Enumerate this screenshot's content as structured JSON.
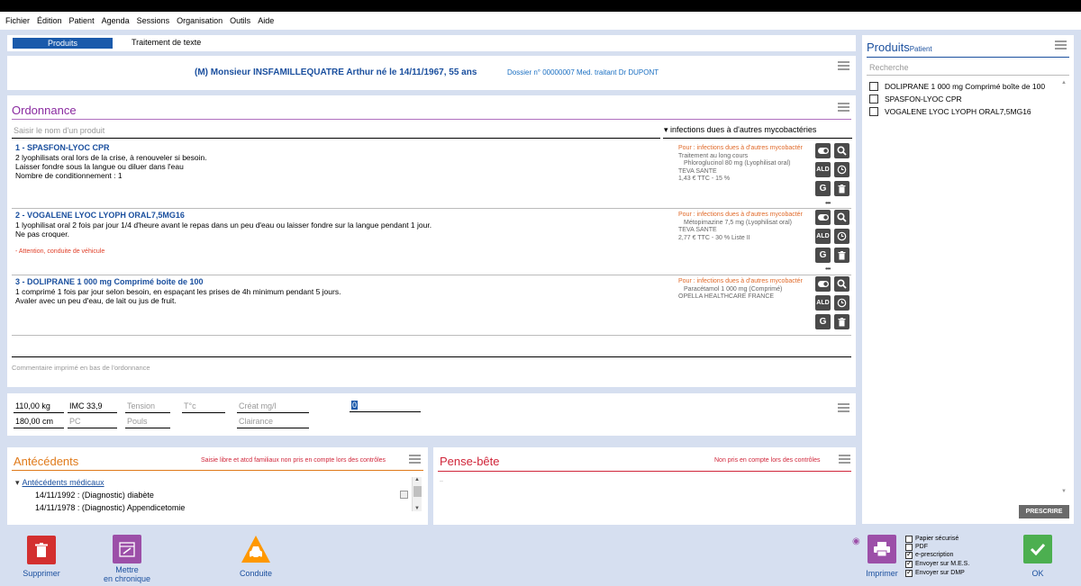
{
  "menu": [
    "Fichier",
    "Édition",
    "Patient",
    "Agenda",
    "Sessions",
    "Organisation",
    "Outils",
    "Aide"
  ],
  "tabs": {
    "active": "Produits",
    "other": "Traitement de texte"
  },
  "patient": {
    "line": "(M) Monsieur INSFAMILLEQUATRE Arthur né le 14/11/1967, 55 ans",
    "dossier": "Dossier n° 00000007 Med. traitant Dr DUPONT"
  },
  "ordonnance": {
    "title": "Ordonnance",
    "input_placeholder": "Saisir le nom d'un produit",
    "indication": "infections dues à d'autres mycobactéries",
    "items": [
      {
        "name": "1 - SPASFON-LYOC CPR",
        "lines": [
          "2 lyophilisats oral lors de la crise, à renouveler si besoin.",
          "Laisser fondre sous la langue ou diluer dans l'eau",
          "Nombre de conditionnement : 1"
        ],
        "warning": "",
        "pour": "Pour : infections dues à d'autres mycobactér",
        "meta": [
          "Traitement au long cours",
          "Phloroglucinol 80 mg (Lyophilisat oral)",
          "TEVA SANTE",
          "1,43 € TTC - 15 %"
        ]
      },
      {
        "name": "2 - VOGALENE LYOC LYOPH ORAL7,5MG16",
        "lines": [
          "1 lyophilisat oral 2 fois par jour 1/4 d'heure avant le repas dans un peu d'eau ou laisser fondre sur la langue pendant 1 jour.",
          "Ne pas croquer."
        ],
        "warning": "- Attention, conduite de véhicule",
        "pour": "Pour : infections dues à d'autres mycobactér",
        "meta": [
          "Métopimazine 7,5 mg (Lyophilisat oral)",
          "TEVA SANTE",
          "2,77 € TTC - 30 % Liste II"
        ]
      },
      {
        "name": "3 - DOLIPRANE 1 000 mg Comprimé boîte de 100",
        "lines": [
          "1 comprimé 1 fois par jour selon besoin, en espaçant les prises de 4h minimum pendant 5 jours.",
          "Avaler avec un peu d'eau, de lait ou jus de fruit."
        ],
        "warning": "",
        "pour": "Pour : infections dues à d'autres mycobactér",
        "meta": [
          "Paracétamol 1 000 mg (Comprimé)",
          "OPELLA HEALTHCARE FRANCE"
        ]
      }
    ],
    "action_labels": {
      "ald": "ALD",
      "g": "G"
    },
    "comment_placeholder": "Commentaire imprimé en bas de l'ordonnance"
  },
  "vitals": {
    "weight": "110,00 kg",
    "imc": "IMC 33,9",
    "tension": "Tension",
    "temp": "T°c",
    "creat": "Créat mg/l",
    "zero": "0",
    "height": "180,00 cm",
    "pc": "PC",
    "pouls": "Pouls",
    "clairance": "Clairance"
  },
  "antecedents": {
    "title": "Antécédents",
    "note": "Saisie libre et atcd familiaux non pris en compte lors des contrôles",
    "group": "Antécédents médicaux",
    "items": [
      "14/11/1992 : (Diagnostic) diabète",
      "14/11/1978 : (Diagnostic) Appendicetomie"
    ]
  },
  "pensebete": {
    "title": "Pense-bête",
    "note": "Non pris en compte lors des contrôles",
    "content": ".."
  },
  "produits": {
    "title": "Produits",
    "subtitle": "Patient",
    "search_placeholder": "Recherche",
    "items": [
      "DOLIPRANE 1 000 mg Comprimé boîte de 100",
      "SPASFON-LYOC CPR",
      "VOGALENE LYOC LYOPH ORAL7,5MG16"
    ],
    "prescrire": "PRESCRIRE"
  },
  "bottom": {
    "supprimer": "Supprimer",
    "mettre": "Mettre",
    "chronique": "en chronique",
    "conduite": "Conduite",
    "imprimer": "Imprimer",
    "ok": "OK",
    "options": [
      {
        "label": "Papier sécurisé",
        "checked": false
      },
      {
        "label": "PDF",
        "checked": false
      },
      {
        "label": "e-prescription",
        "checked": true
      },
      {
        "label": "Envoyer sur M.E.S.",
        "checked": true
      },
      {
        "label": "Envoyer sur DMP",
        "checked": true
      }
    ]
  },
  "colors": {
    "accent": "#1a5aab",
    "workspace": "#d6dff0",
    "green": "#4caf50",
    "red": "#d32f2f",
    "orange": "#ff9800",
    "purple": "#9c4fa8"
  }
}
